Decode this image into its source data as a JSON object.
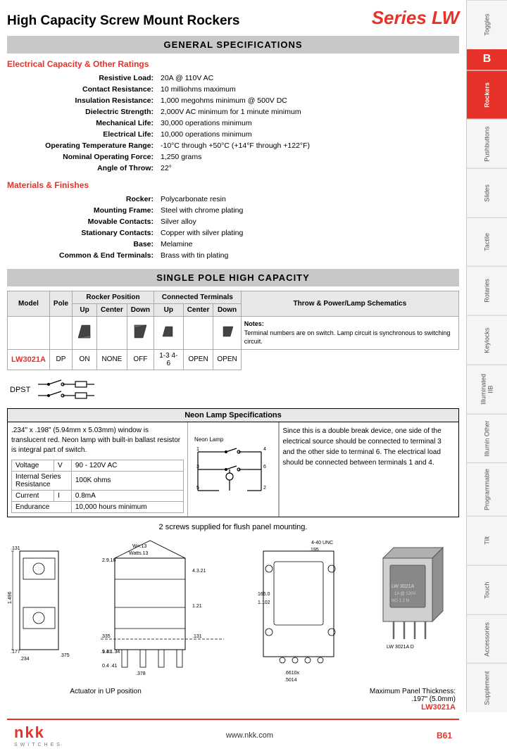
{
  "header": {
    "title": "High Capacity Screw Mount Rockers",
    "series": "Series LW"
  },
  "general_specs": {
    "section_title": "GENERAL SPECIFICATIONS",
    "electrical_section": "Electrical Capacity & Other Ratings",
    "electrical_specs": [
      {
        "label": "Resistive Load:",
        "value": "20A @ 110V AC"
      },
      {
        "label": "Contact Resistance:",
        "value": "10 milliohms maximum"
      },
      {
        "label": "Insulation Resistance:",
        "value": "1,000 megohms minimum @ 500V DC"
      },
      {
        "label": "Dielectric Strength:",
        "value": "2,000V AC minimum for 1 minute minimum"
      },
      {
        "label": "Mechanical Life:",
        "value": "30,000 operations minimum"
      },
      {
        "label": "Electrical Life:",
        "value": "10,000 operations minimum"
      },
      {
        "label": "Operating Temperature Range:",
        "value": "-10°C through +50°C (+14°F through +122°F)"
      },
      {
        "label": "Nominal Operating Force:",
        "value": "1,250 grams"
      },
      {
        "label": "Angle of Throw:",
        "value": "22°"
      }
    ],
    "materials_section": "Materials & Finishes",
    "materials_specs": [
      {
        "label": "Rocker:",
        "value": "Polycarbonate resin"
      },
      {
        "label": "Mounting Frame:",
        "value": "Steel with chrome plating"
      },
      {
        "label": "Movable Contacts:",
        "value": "Silver alloy"
      },
      {
        "label": "Stationary Contacts:",
        "value": "Copper with silver plating"
      },
      {
        "label": "Base:",
        "value": "Melamine"
      },
      {
        "label": "Common & End Terminals:",
        "value": "Brass with tin plating"
      }
    ]
  },
  "single_pole": {
    "section_title": "SINGLE POLE HIGH CAPACITY",
    "rocker_position": "Rocker Position",
    "connected_terminals": "Connected Terminals",
    "throw_power": "Throw & Power/Lamp Schematics",
    "col_up": "Up",
    "col_center": "Center",
    "col_down": "Down",
    "col_model": "Model",
    "col_pole": "Pole",
    "notes_header": "Notes:",
    "notes_text": "Terminal numbers are on switch. Lamp circuit is synchronous to switching circuit.",
    "row": {
      "model": "LW3021A",
      "pole": "DP",
      "up_pos": "ON",
      "center_pos": "NONE",
      "down_pos": "OFF",
      "up_term": "1-3  4-6",
      "center_term": "OPEN",
      "down_term": "OPEN",
      "schematic": "DPST"
    }
  },
  "neon_lamp": {
    "header": "Neon Lamp Specifications",
    "description": ".234\" x .198\" (5.94mm x 5.03mm) window is translucent red. Neon lamp with built-in ballast resistor is integral part of switch.",
    "voltage_label": "Voltage",
    "voltage_unit": "V",
    "voltage_value": "90 - 120V AC",
    "resistance_label": "Internal Series Resistance",
    "resistance_value": "100K ohms",
    "current_label": "Current",
    "current_unit": "I",
    "current_value": "0.8mA",
    "endurance_label": "Endurance",
    "endurance_value": "10,000 hours minimum",
    "right_text": "Since this is a double break device, one side of the electrical source should be connected to terminal 3 and the other side to terminal 6. The electrical load should be connected between terminals 1 and 4."
  },
  "flush_mount": "2 screws supplied for flush panel mounting.",
  "diagrams": {
    "actuator_note": "Actuator in UP position",
    "panel_thickness_label": "Maximum Panel Thickness:",
    "panel_thickness_value": ".197\" (5.0mm)",
    "model_label": "LW3021A"
  },
  "footer": {
    "logo": "nkk",
    "switches": "SWITCHES",
    "url": "www.nkk.com",
    "page": "B61"
  },
  "sidebar": {
    "tabs": [
      {
        "label": "Toggles",
        "active": false
      },
      {
        "label": "B",
        "active": true,
        "is_b": true
      },
      {
        "label": "Rockers",
        "active": false
      },
      {
        "label": "Pushbuttons",
        "active": false
      },
      {
        "label": "Slides",
        "active": false
      },
      {
        "label": "Tactile",
        "active": false
      },
      {
        "label": "Rotaries",
        "active": false
      },
      {
        "label": "Keylocks",
        "active": false
      },
      {
        "label": "Illuminated IIB",
        "active": false
      },
      {
        "label": "Illuminin Other",
        "active": false
      },
      {
        "label": "Programmable",
        "active": false
      },
      {
        "label": "Tilt",
        "active": false
      },
      {
        "label": "Touch",
        "active": false
      },
      {
        "label": "Accessories",
        "active": false
      },
      {
        "label": "Supplement",
        "active": false
      }
    ]
  }
}
